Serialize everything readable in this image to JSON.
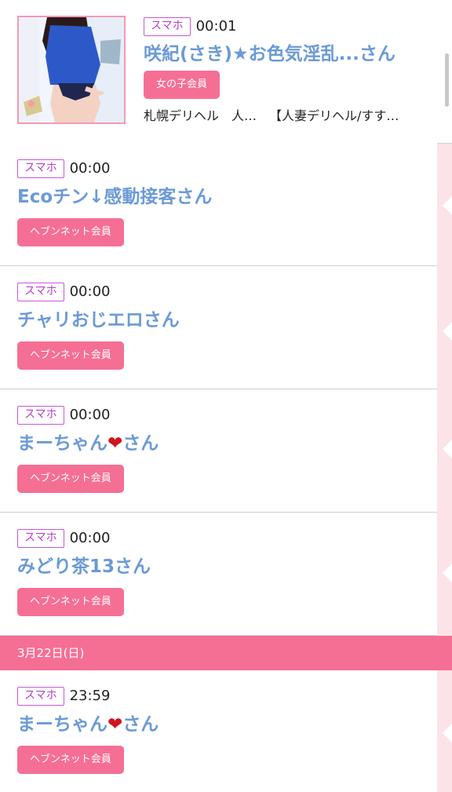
{
  "top_entry": {
    "device": "スマホ",
    "time": "00:01",
    "name": "咲紀(さき)★お色気淫乱...さん",
    "member_type": "女の子会員",
    "shop_category": "札幌デリヘル　人…",
    "shop_name": "【人妻デリヘル/すす…"
  },
  "entries": [
    {
      "device": "スマホ",
      "time": "00:00",
      "name": "Ecoチン↓感動接客さん",
      "member_type": "ヘブンネット会員"
    },
    {
      "device": "スマホ",
      "time": "00:00",
      "name": "チャリおじエロさん",
      "member_type": "ヘブンネット会員"
    },
    {
      "device": "スマホ",
      "time": "00:00",
      "name_prefix": "まーちゃん",
      "name_emoji": "❤",
      "name_suffix": "さん",
      "member_type": "ヘブンネット会員"
    },
    {
      "device": "スマホ",
      "time": "00:00",
      "name": "みどり茶13さん",
      "member_type": "ヘブンネット会員"
    }
  ],
  "date_header": "3月22日(日)",
  "after_date_entries": [
    {
      "device": "スマホ",
      "time": "23:59",
      "name_prefix": "まーちゃん",
      "name_emoji": "❤",
      "name_suffix": "さん",
      "member_type": "ヘブンネット会員"
    }
  ],
  "colors": {
    "accent_pink": "#f56f95",
    "name_blue": "#6b9ad6",
    "badge_purple": "#c858d8",
    "gutter_pink": "#fbe3e8"
  }
}
